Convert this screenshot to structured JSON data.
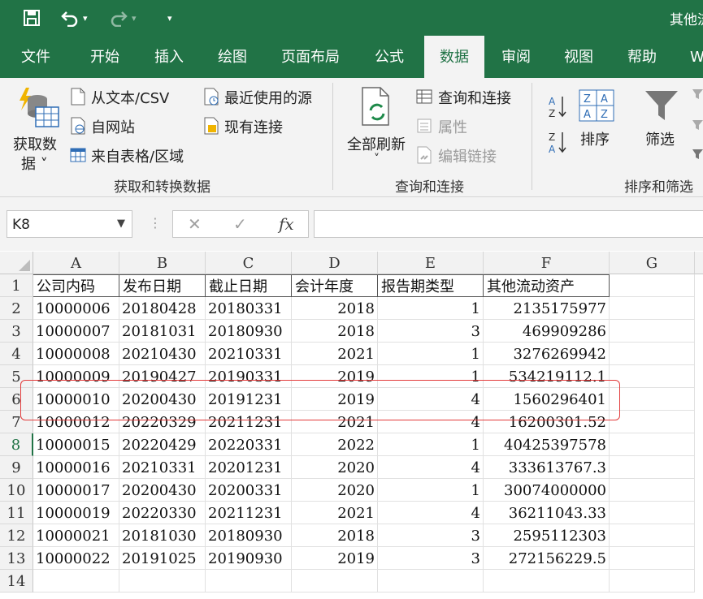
{
  "window": {
    "title": "其他流"
  },
  "qat": {
    "dropdown_glyph": "▾",
    "customize_glyph": "▾"
  },
  "tabs": [
    {
      "label": "文件",
      "active": false
    },
    {
      "label": "开始",
      "active": false
    },
    {
      "label": "插入",
      "active": false
    },
    {
      "label": "绘图",
      "active": false
    },
    {
      "label": "页面布局",
      "active": false
    },
    {
      "label": "公式",
      "active": false
    },
    {
      "label": "数据",
      "active": true
    },
    {
      "label": "审阅",
      "active": false
    },
    {
      "label": "视图",
      "active": false
    },
    {
      "label": "帮助",
      "active": false
    },
    {
      "label": "W",
      "active": false
    }
  ],
  "ribbon": {
    "get_data": {
      "label_line1": "获取数",
      "label_line2": "据 ˅"
    },
    "from_text": "从文本/CSV",
    "from_web": "自网站",
    "from_table": "来自表格/区域",
    "recent_sources": "最近使用的源",
    "existing_connections": "现有连接",
    "group1_label": "获取和转换数据",
    "refresh_all": {
      "label": "全部刷新",
      "arrow": "˅"
    },
    "queries_connections": "查询和连接",
    "properties": "属性",
    "edit_links": "编辑链接",
    "group2_label": "查询和连接",
    "sort": "排序",
    "filter": "筛选",
    "group3_label": "排序和筛选",
    "colors": {
      "tab_bg": "#217346",
      "ribbon_bg": "#f3f3f3"
    }
  },
  "formula_bar": {
    "name_box": "K8",
    "dots": "⋮",
    "cancel": "✕",
    "enter": "✓",
    "fx": "fx",
    "value": ""
  },
  "sheet": {
    "columns": [
      "A",
      "B",
      "C",
      "D",
      "E",
      "F",
      "G"
    ],
    "row_numbers": [
      "1",
      "2",
      "3",
      "4",
      "5",
      "6",
      "7",
      "8",
      "9",
      "10",
      "11",
      "12",
      "13",
      "14"
    ],
    "selected_row": "8",
    "headers": [
      "公司内码",
      "发布日期",
      "截止日期",
      "会计年度",
      "报告期类型",
      "其他流动资产"
    ],
    "rows": [
      [
        "10000006",
        "20180428",
        "20180331",
        "2018",
        "1",
        "2135175977"
      ],
      [
        "10000007",
        "20181031",
        "20180930",
        "2018",
        "3",
        "469909286"
      ],
      [
        "10000008",
        "20210430",
        "20210331",
        "2021",
        "1",
        "3276269942"
      ],
      [
        "10000009",
        "20190427",
        "20190331",
        "2019",
        "1",
        "534219112.1"
      ],
      [
        "10000010",
        "20200430",
        "20191231",
        "2019",
        "4",
        "1560296401"
      ],
      [
        "10000012",
        "20220329",
        "20211231",
        "2021",
        "4",
        "16200301.52"
      ],
      [
        "10000015",
        "20220429",
        "20220331",
        "2022",
        "1",
        "40425397578"
      ],
      [
        "10000016",
        "20210331",
        "20201231",
        "2020",
        "4",
        "333613767.3"
      ],
      [
        "10000017",
        "20200430",
        "20200331",
        "2020",
        "1",
        "30074000000"
      ],
      [
        "10000019",
        "20220330",
        "20211231",
        "2021",
        "4",
        "36211043.33"
      ],
      [
        "10000021",
        "20181030",
        "20180930",
        "2018",
        "3",
        "2595112303"
      ],
      [
        "10000022",
        "20191025",
        "20190930",
        "2019",
        "3",
        "272156229.5"
      ]
    ],
    "highlight_color": "#e23b3b",
    "highlighted_row": "6"
  }
}
